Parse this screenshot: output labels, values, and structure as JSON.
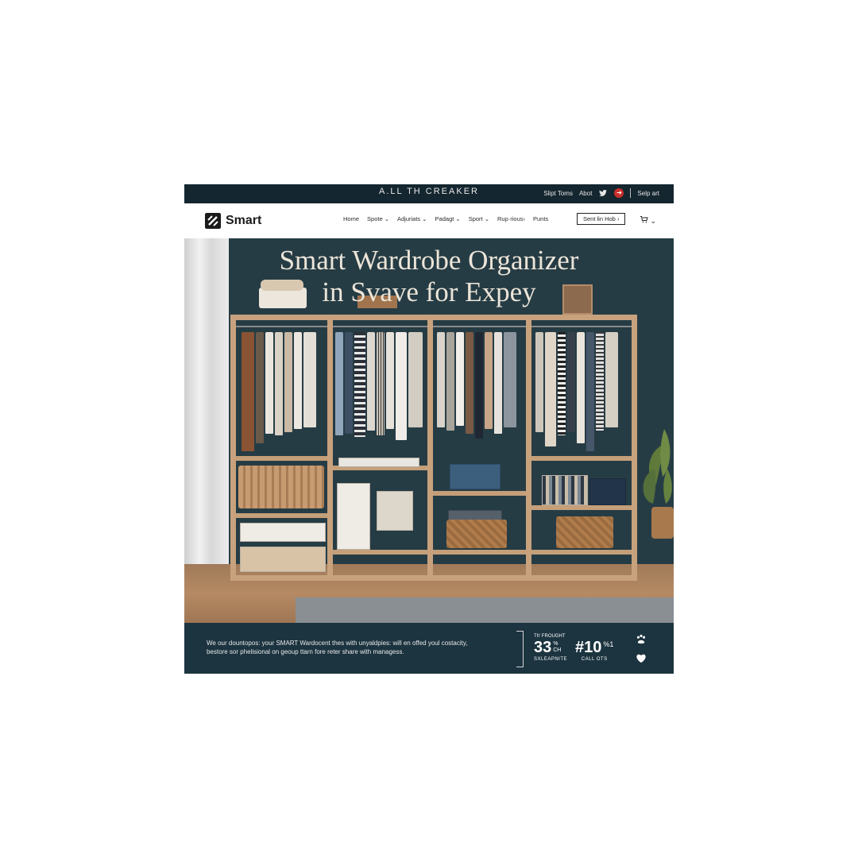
{
  "topbar": {
    "tagline": "A.LL TH CREAKER",
    "links": [
      "Slipt Toms",
      "Abot"
    ],
    "sign_in": "Selp art",
    "twitter_icon": "twitter-icon",
    "badge_icon": "arrow-right-circle-icon"
  },
  "nav": {
    "brand_name": "Smart",
    "logo_icon": "slash-square-logo-icon",
    "menu": [
      "Home",
      "Spote ⌄",
      "Adjuriats ⌄",
      "Padagt ⌄",
      "Sport ⌄",
      "Rup·rious›",
      "Punts"
    ],
    "cta_label": "Sent lin Hob ›",
    "cart_icon": "cart-icon",
    "cart_caret": "⌄"
  },
  "hero": {
    "title_line1": "Smart Wardrobe Organizer",
    "title_line2": "in Svave for Expey"
  },
  "footer": {
    "description_line1": "We our dountopos: your SMART Wardocent thes with unyaldpies: will en offed youl costacity,",
    "description_line2": "bestore sor phelisional on geoup ttarn fore reter share with managess.",
    "stat1_top": "Th' FROUGHT",
    "stat1_num": "33",
    "stat1_sup": "%",
    "stat1_sub": "CH",
    "stat1_label": "SXLEAPNITE",
    "stat2_num": "#10",
    "stat2_sup": "%1",
    "stat2_label": "CALL OTS",
    "icon_top": "paw-icon",
    "icon_bottom": "heart-icon"
  },
  "colors": {
    "topbar_bg": "#14262f",
    "hero_wall": "#263c45",
    "footer_bg": "#1c3440",
    "wood": "#c7a27d",
    "title_text": "#ece5d8"
  }
}
